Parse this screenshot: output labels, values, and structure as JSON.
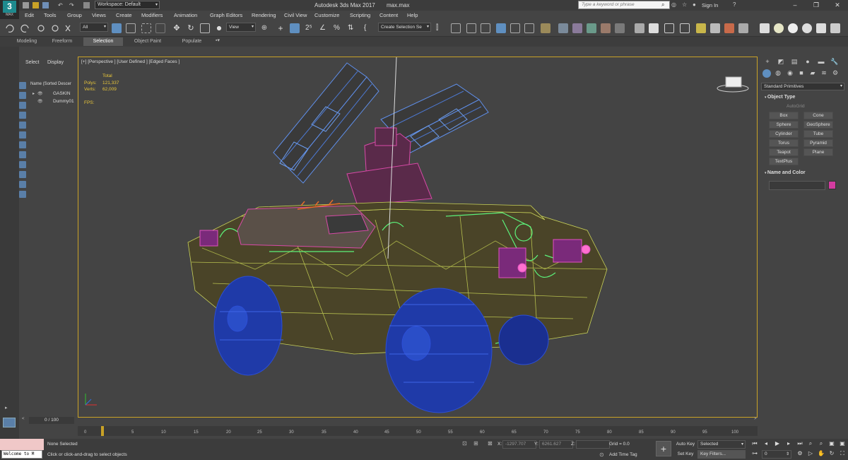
{
  "app": {
    "logo_text": "3",
    "logo_sub": "MAX",
    "title": "Autodesk 3ds Max 2017",
    "document": "max.max",
    "workspace": "Workspace: Default",
    "search_placeholder": "Type a keyword or phrase",
    "sign_in": "Sign In"
  },
  "menu": [
    "Edit",
    "Tools",
    "Group",
    "Views",
    "Create",
    "Modifiers",
    "Animation",
    "Graph Editors",
    "Rendering",
    "Civil View",
    "Customize",
    "Scripting",
    "Content",
    "Help"
  ],
  "toolbar": {
    "filter": "All",
    "ref_coord": "View",
    "selection_set": "Create Selection Se"
  },
  "ribbon_tabs": [
    "Modeling",
    "Freeform",
    "Selection",
    "Object Paint",
    "Populate"
  ],
  "ribbon_active": "Selection",
  "scene_explorer": {
    "tabs": [
      "Select",
      "Display"
    ],
    "column_header": "Name (Sorted Descer",
    "items": [
      "GASKIN",
      "Dummy01"
    ]
  },
  "viewport": {
    "label": "[+] [Perspective ] [User Defined ] [Edged Faces ]",
    "stats": {
      "total_label": "Total",
      "polys_label": "Polys:",
      "polys": "121,337",
      "verts_label": "Verts:",
      "verts": "62,009",
      "fps_label": "FPS:"
    }
  },
  "command_panel": {
    "category": "Standard Primitives",
    "object_type_title": "Object Type",
    "autogrid": "AutoGrid",
    "primitives": [
      "Box",
      "Cone",
      "Sphere",
      "GeoSphere",
      "Cylinder",
      "Tube",
      "Torus",
      "Pyramid",
      "Teapot",
      "Plane",
      "TextPlus"
    ],
    "name_color_title": "Name and Color",
    "object_color": "#d33ca0"
  },
  "timeline": {
    "frame_indicator": "0 / 100",
    "ticks": [
      "0",
      "5",
      "10",
      "15",
      "20",
      "25",
      "30",
      "35",
      "40",
      "45",
      "50",
      "55",
      "60",
      "65",
      "70",
      "75",
      "80",
      "85",
      "90",
      "95",
      "100"
    ]
  },
  "status": {
    "maxscript_output": "Welcome to M",
    "selection": "None Selected",
    "prompt": "Click or click-and-drag to select objects",
    "x_label": "X:",
    "x_val": "-1297.707",
    "y_label": "Y:",
    "y_val": "6261.627",
    "z_label": "Z:",
    "z_val": "",
    "grid": "Grid = 0.0",
    "add_time_tag": "Add Time Tag",
    "auto_key": "Auto Key",
    "set_key": "Set Key",
    "key_mode": "Selected",
    "key_filters": "Key Filters...",
    "current_frame": "0"
  },
  "colors": {
    "selection_accent": "#5f8fc0",
    "viewport_border": "#c9a227",
    "stats_text": "#e8c63a",
    "wire_body": "#c8d25a",
    "wire_wheels": "#2c4fd6",
    "wire_launcher": "#5f8ee8",
    "wire_magenta": "#c13a9c",
    "wire_green": "#5cf27a",
    "wire_orange": "#e86a2a"
  }
}
